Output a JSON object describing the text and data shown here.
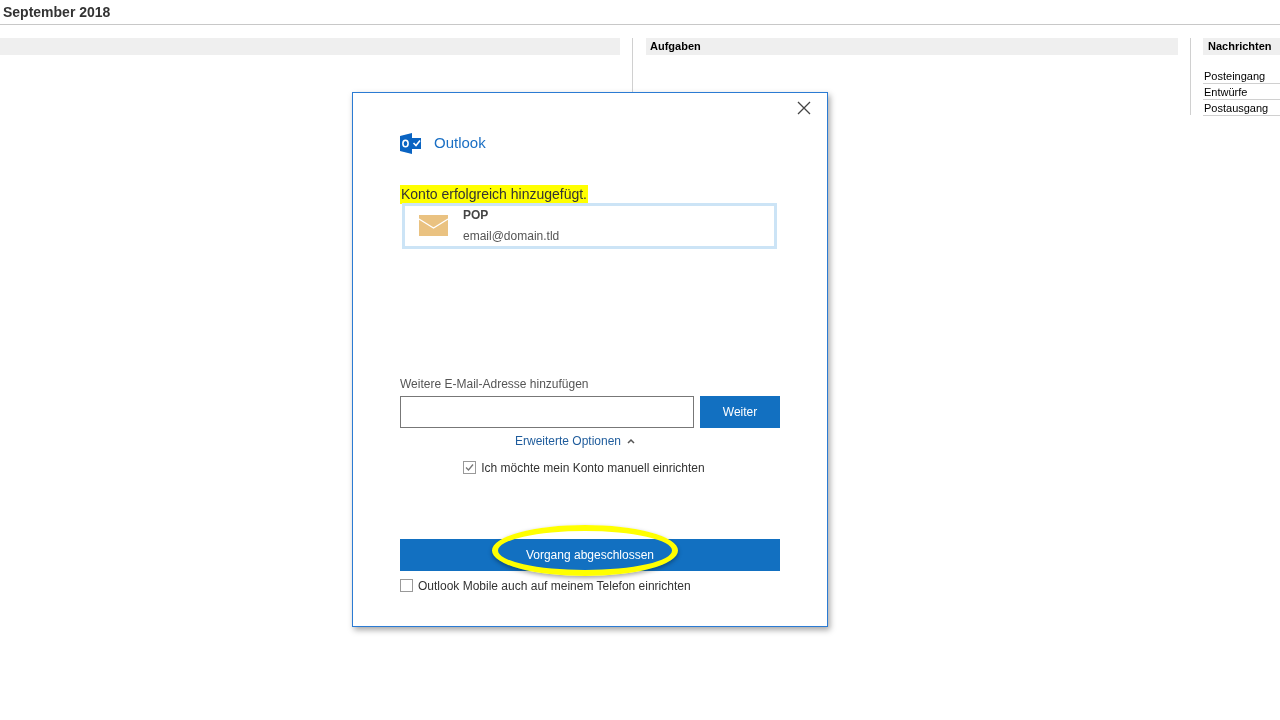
{
  "header": {
    "title": "September 2018"
  },
  "tasks": {
    "title": "Aufgaben"
  },
  "messages": {
    "title": "Nachrichten",
    "items": [
      "Posteingang",
      "Entwürfe",
      "Postausgang"
    ]
  },
  "dialog": {
    "brand": "Outlook",
    "success": "Konto erfolgreich hinzugefügt.",
    "account": {
      "type": "POP",
      "email": "email@domain.tld"
    },
    "add_label": "Weitere E-Mail-Adresse hinzufügen",
    "next_button": "Weiter",
    "advanced": {
      "label": "Erweiterte Optionen",
      "expanded": true
    },
    "manual": {
      "label": "Ich möchte mein Konto manuell einrichten",
      "checked": true
    },
    "finish_button": "Vorgang abgeschlossen",
    "mobile": {
      "label": "Outlook Mobile auch auf meinem Telefon einrichten",
      "checked": false
    }
  }
}
